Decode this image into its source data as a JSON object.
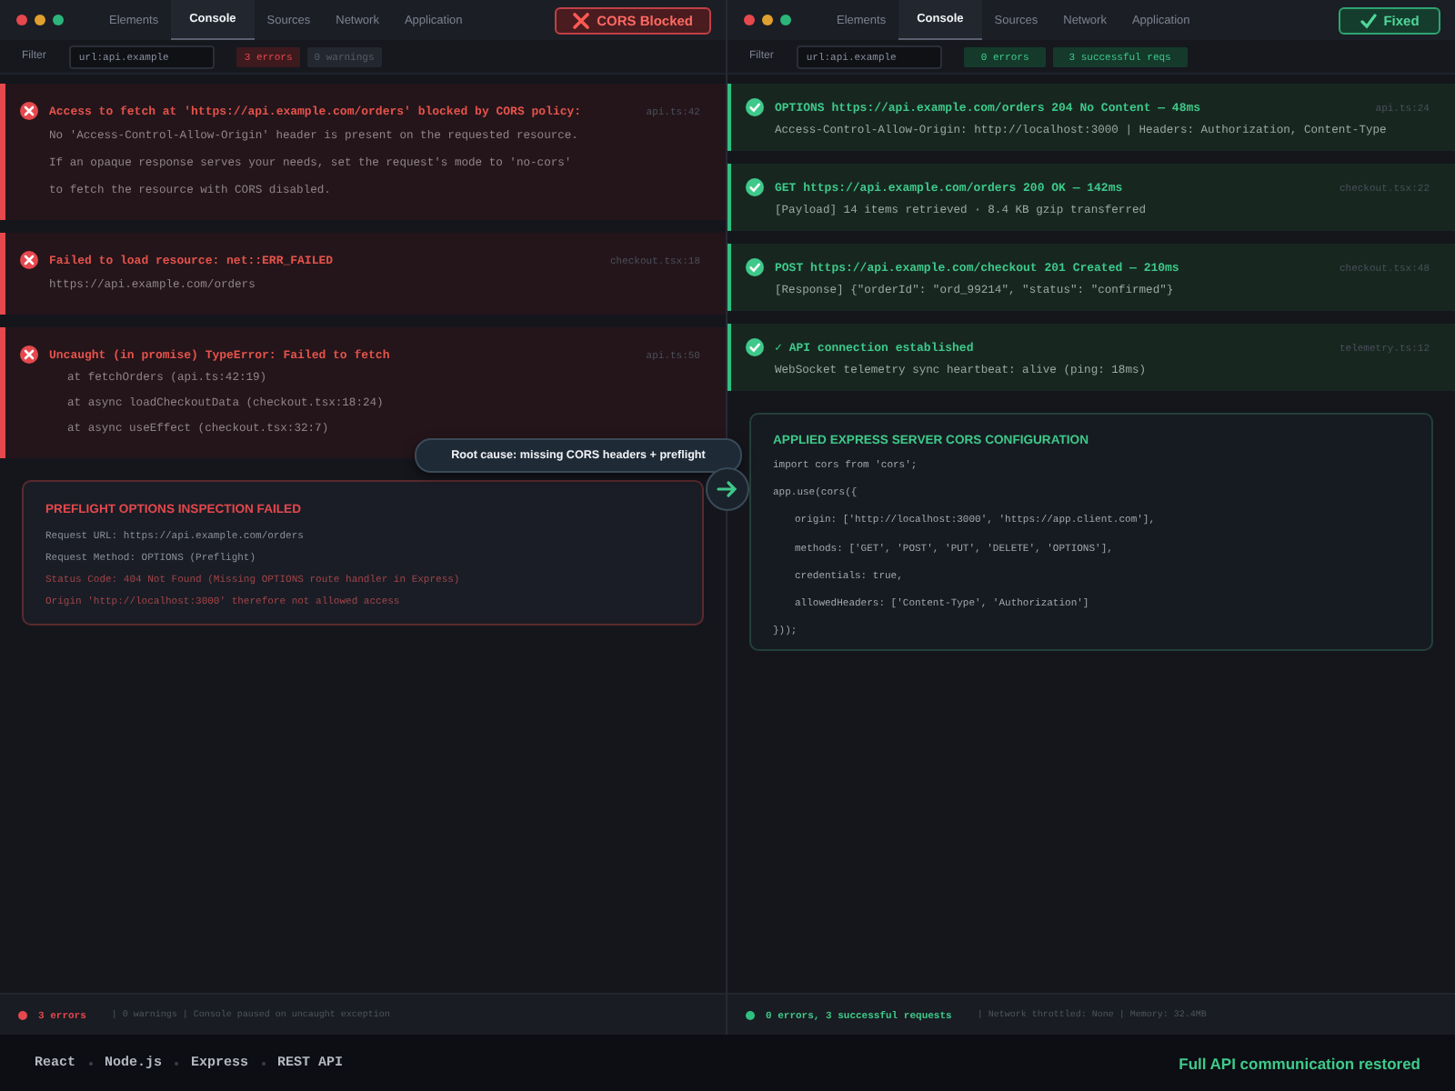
{
  "panes": [
    {
      "kind": "broken",
      "tabs": [
        {
          "label": "Elements",
          "selected": false
        },
        {
          "label": "Console",
          "selected": true
        },
        {
          "label": "Sources",
          "selected": false
        },
        {
          "label": "Network",
          "selected": false
        },
        {
          "label": "Application",
          "selected": false
        }
      ],
      "status_button": {
        "label": "CORS Blocked"
      },
      "filter": {
        "label": "Filter",
        "value": "url:api.example"
      },
      "counters": [
        {
          "label": "3 errors",
          "kind": "error"
        },
        {
          "label": "0 warnings",
          "kind": "muted"
        }
      ],
      "entries": [
        {
          "title": "Access to fetch at 'https://api.example.com/orders' blocked by CORS policy:",
          "source": "api.ts:42",
          "lines": [
            {
              "text": "No 'Access-Control-Allow-Origin' header is present on the requested resource.",
              "kind": "text"
            },
            {
              "text": "If an opaque response serves your needs, set the request's mode to 'no-cors'",
              "kind": "text"
            },
            {
              "text": "to fetch the resource with CORS disabled.",
              "kind": "text"
            }
          ]
        },
        {
          "title": "Failed to load resource: net::ERR_FAILED",
          "source": "checkout.tsx:18",
          "lines": [
            {
              "text": "https://api.example.com/orders",
              "kind": "text"
            }
          ]
        },
        {
          "title": "Uncaught (in promise) TypeError: Failed to fetch",
          "source": "api.ts:50",
          "lines": [
            {
              "text": "at fetchOrders (api.ts:42:19)",
              "kind": "stack"
            },
            {
              "text": "at async loadCheckoutData (checkout.tsx:18:24)",
              "kind": "stack"
            },
            {
              "text": "at async useEffect (checkout.tsx:32:7)",
              "kind": "stack"
            }
          ]
        }
      ],
      "panel": {
        "title": "PREFLIGHT OPTIONS INSPECTION FAILED",
        "lines": [
          {
            "text": "Request URL: https://api.example.com/orders",
            "kind": "text"
          },
          {
            "text": "Request Method: OPTIONS (Preflight)",
            "kind": "text"
          },
          {
            "text": "Status Code: 404 Not Found (Missing OPTIONS route handler in Express)",
            "kind": "error"
          },
          {
            "text": "Origin 'http://localhost:3000' therefore not allowed access",
            "kind": "error"
          }
        ]
      },
      "status_bar": {
        "summary": "3 errors",
        "detail": "| 0 warnings | Console paused on uncaught exception"
      }
    },
    {
      "kind": "fixed",
      "tabs": [
        {
          "label": "Elements",
          "selected": false
        },
        {
          "label": "Console",
          "selected": true
        },
        {
          "label": "Sources",
          "selected": false
        },
        {
          "label": "Network",
          "selected": false
        },
        {
          "label": "Application",
          "selected": false
        }
      ],
      "status_button": {
        "label": "Fixed"
      },
      "filter": {
        "label": "Filter",
        "value": "url:api.example"
      },
      "counters": [
        {
          "label": "0 errors",
          "kind": "success"
        },
        {
          "label": "3 successful reqs",
          "kind": "success"
        }
      ],
      "entries": [
        {
          "title": "OPTIONS https://api.example.com/orders 204 No Content — 48ms",
          "source": "api.ts:24",
          "lines": [
            {
              "text": "Access-Control-Allow-Origin: http://localhost:3000 | Headers: Authorization, Content-Type",
              "kind": "text"
            }
          ]
        },
        {
          "title": "GET https://api.example.com/orders 200 OK — 142ms",
          "source": "checkout.tsx:22",
          "lines": [
            {
              "text": "[Payload] 14 items retrieved · 8.4 KB gzip transferred",
              "kind": "text"
            }
          ]
        },
        {
          "title": "POST https://api.example.com/checkout 201 Created — 210ms",
          "source": "checkout.tsx:48",
          "lines": [
            {
              "text": "[Response] {\"orderId\": \"ord_99214\", \"status\": \"confirmed\"}",
              "kind": "text"
            }
          ]
        },
        {
          "title": "✓ API connection established",
          "source": "telemetry.ts:12",
          "lines": [
            {
              "text": "WebSocket telemetry sync heartbeat: alive (ping: 18ms)",
              "kind": "text"
            }
          ]
        }
      ],
      "panel": {
        "title": "APPLIED EXPRESS SERVER CORS CONFIGURATION",
        "lines": [
          {
            "text": "import cors from 'cors';",
            "kind": "code"
          },
          {
            "text": "app.use(cors({",
            "kind": "code"
          },
          {
            "text": "origin: ['http://localhost:3000', 'https://app.client.com'],",
            "kind": "code-indent"
          },
          {
            "text": "methods: ['GET', 'POST', 'PUT', 'DELETE', 'OPTIONS'],",
            "kind": "code-indent"
          },
          {
            "text": "credentials: true,",
            "kind": "code-indent"
          },
          {
            "text": "allowedHeaders: ['Content-Type', 'Authorization']",
            "kind": "code-indent"
          },
          {
            "text": "}));",
            "kind": "code"
          }
        ]
      },
      "status_bar": {
        "summary": "0 errors, 3 successful requests",
        "detail": "| Network throttled: None | Memory: 32.4MB"
      }
    }
  ],
  "callout": {
    "label": "Root cause: missing CORS headers + preflight"
  },
  "footer": {
    "stack": [
      "React",
      "Node.js",
      "Express",
      "REST API"
    ],
    "message": "Full API communication restored"
  }
}
